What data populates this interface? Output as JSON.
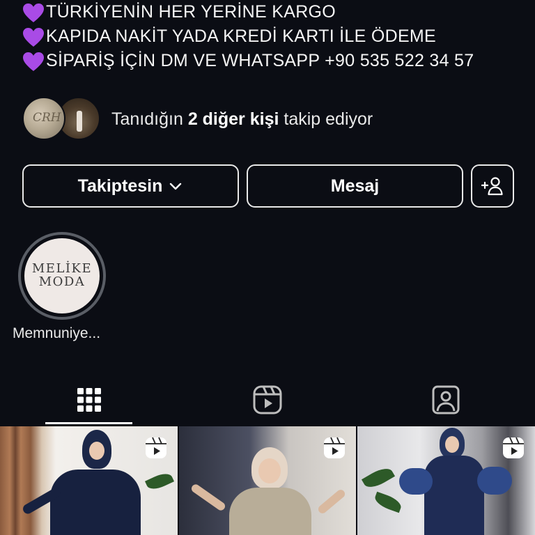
{
  "bio": {
    "lines": [
      "TÜRKİYENİN HER YERİNE KARGO",
      "KAPIDA NAKİT YADA KREDİ KARTI İLE ÖDEME",
      "SİPARİŞ İÇİN DM VE WHATSAPP +90 535 522 34 57"
    ],
    "bullet_icon": "purple-heart-emoji",
    "bullet_color": "#a94be6"
  },
  "followed_by": {
    "prefix": "Tanıdığın ",
    "bold": "2 diğer kişi",
    "suffix": " takip ediyor",
    "avatar_1_text": "CRH"
  },
  "actions": {
    "following_label": "Takiptesin",
    "message_label": "Mesaj",
    "add_user_icon": "add-person-icon"
  },
  "highlight": {
    "logo_line_1": "MELİKE",
    "logo_line_2": "MODA",
    "label": "Memnuniye..."
  },
  "tabs": [
    {
      "name": "posts",
      "icon": "grid-icon",
      "active": true
    },
    {
      "name": "reels",
      "icon": "reels-icon",
      "active": false
    },
    {
      "name": "tagged",
      "icon": "tagged-person-icon",
      "active": false
    }
  ],
  "posts": [
    {
      "type": "reel",
      "icon": "reels-icon"
    },
    {
      "type": "reel",
      "icon": "reels-icon"
    },
    {
      "type": "reel",
      "icon": "reels-icon"
    }
  ],
  "colors": {
    "background": "#0b0d14",
    "text": "#f2f2f2",
    "button_border": "#e9e9e9",
    "highlight_ring": "#5a5e66"
  }
}
